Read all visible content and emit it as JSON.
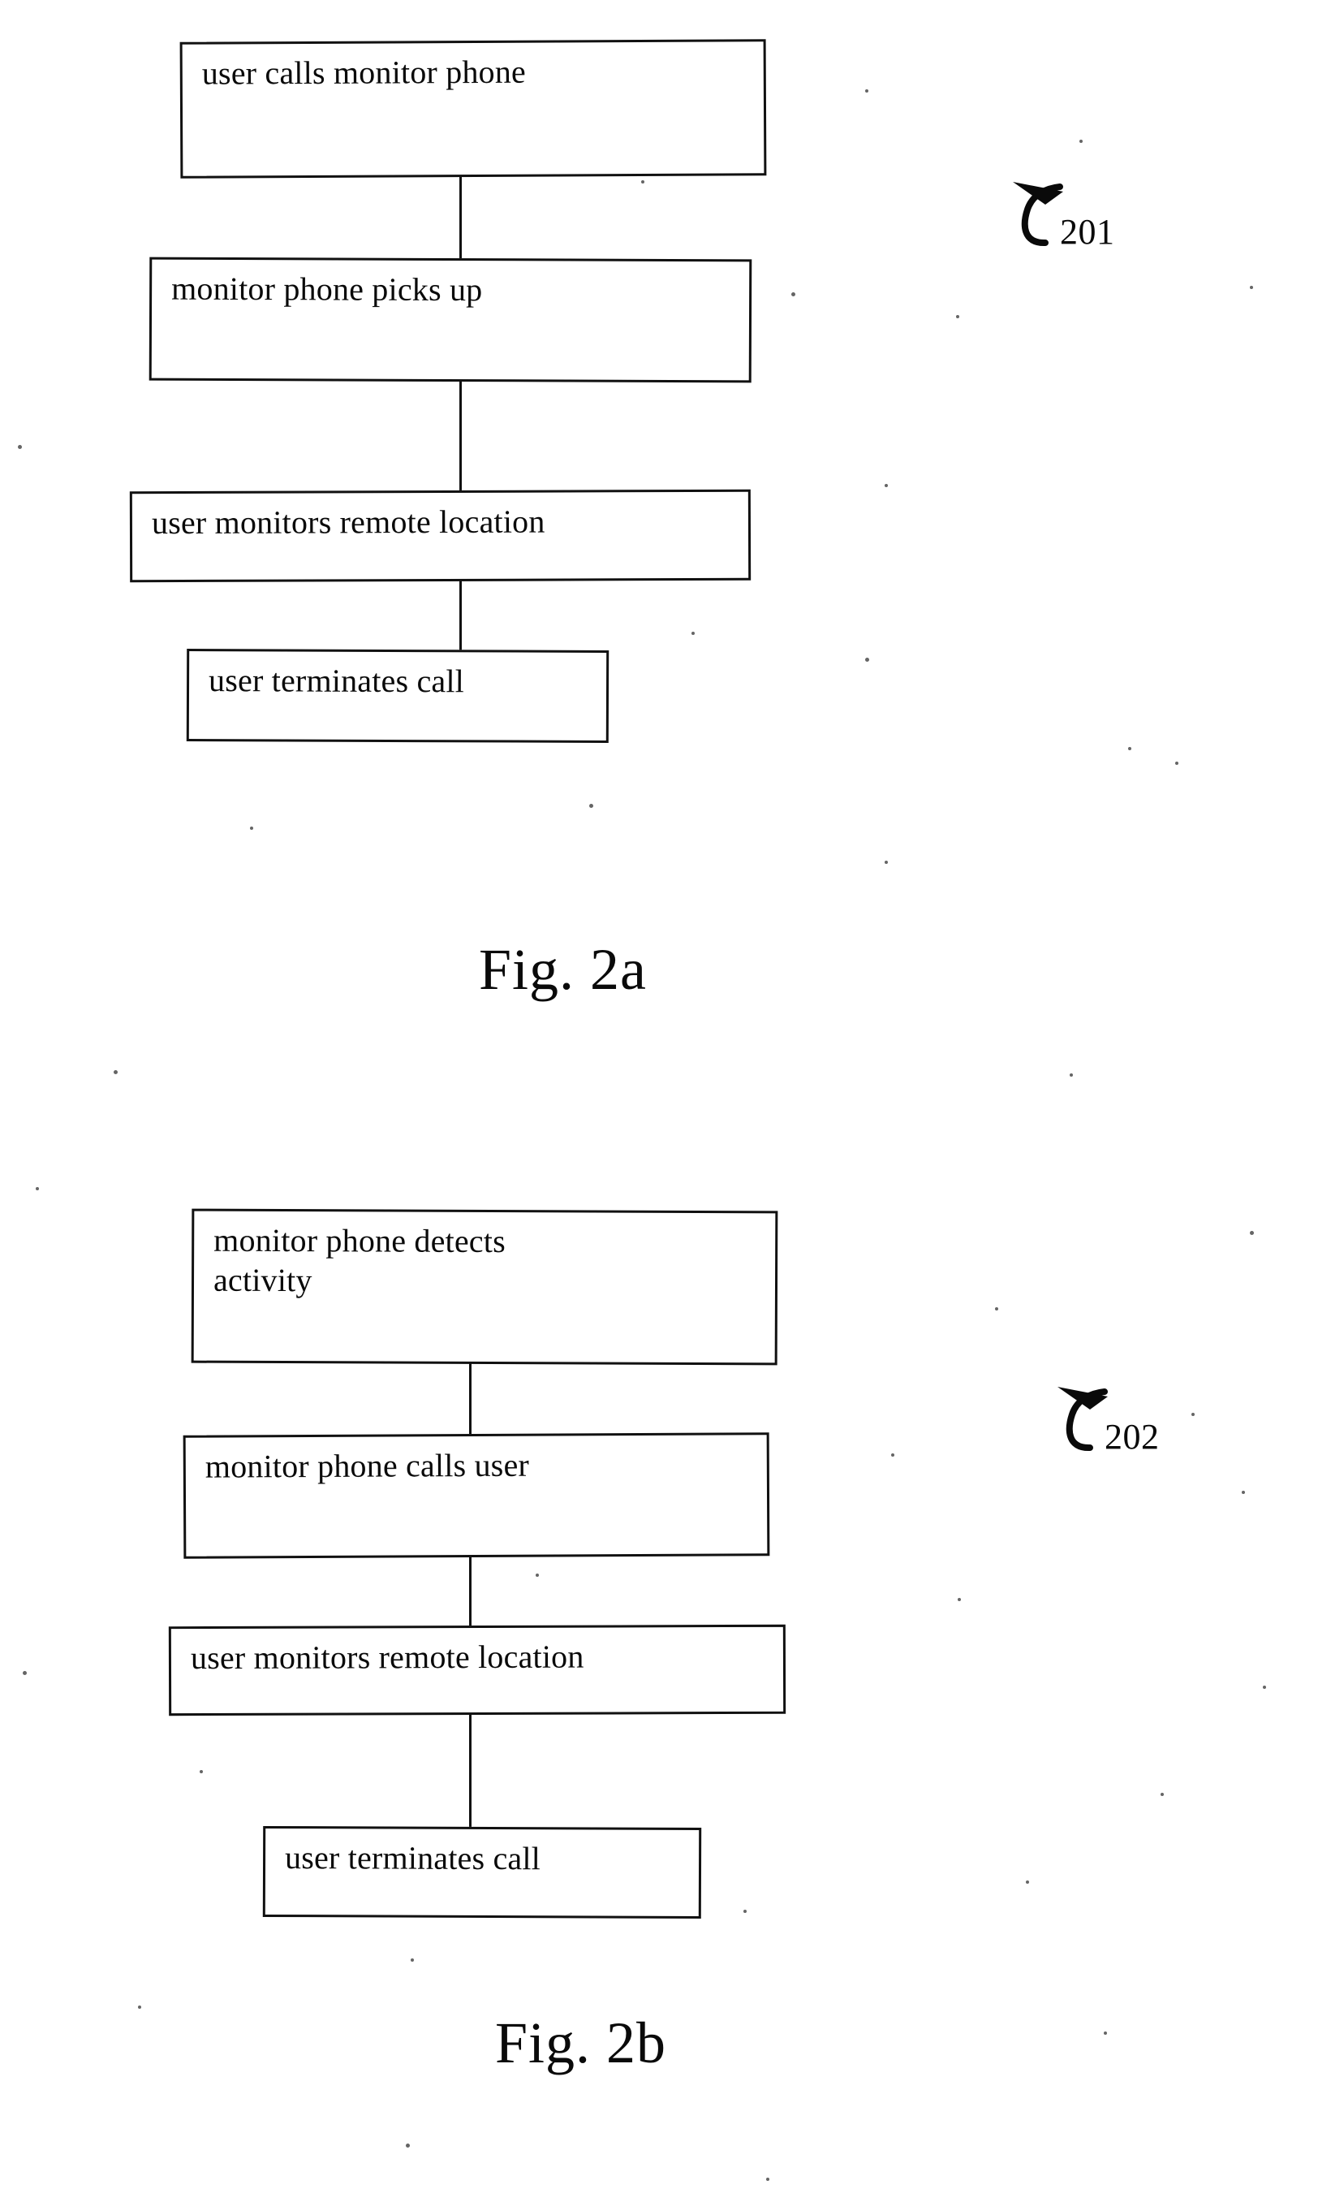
{
  "document": {
    "type": "patent-flowchart-figure",
    "page_background": "#ffffff",
    "ink_color": "#111111"
  },
  "figures": [
    {
      "caption": "Fig. 2a",
      "reference_numeral": "201",
      "boxes": [
        {
          "label": "user calls monitor phone"
        },
        {
          "label": "monitor phone picks up"
        },
        {
          "label": "user monitors remote location"
        },
        {
          "label": "user terminates call"
        }
      ]
    },
    {
      "caption": "Fig. 2b",
      "reference_numeral": "202",
      "boxes": [
        {
          "label": "monitor phone detects\nactivity"
        },
        {
          "label": "monitor phone calls user"
        },
        {
          "label": "user monitors remote location"
        },
        {
          "label": "user terminates call"
        }
      ]
    }
  ]
}
